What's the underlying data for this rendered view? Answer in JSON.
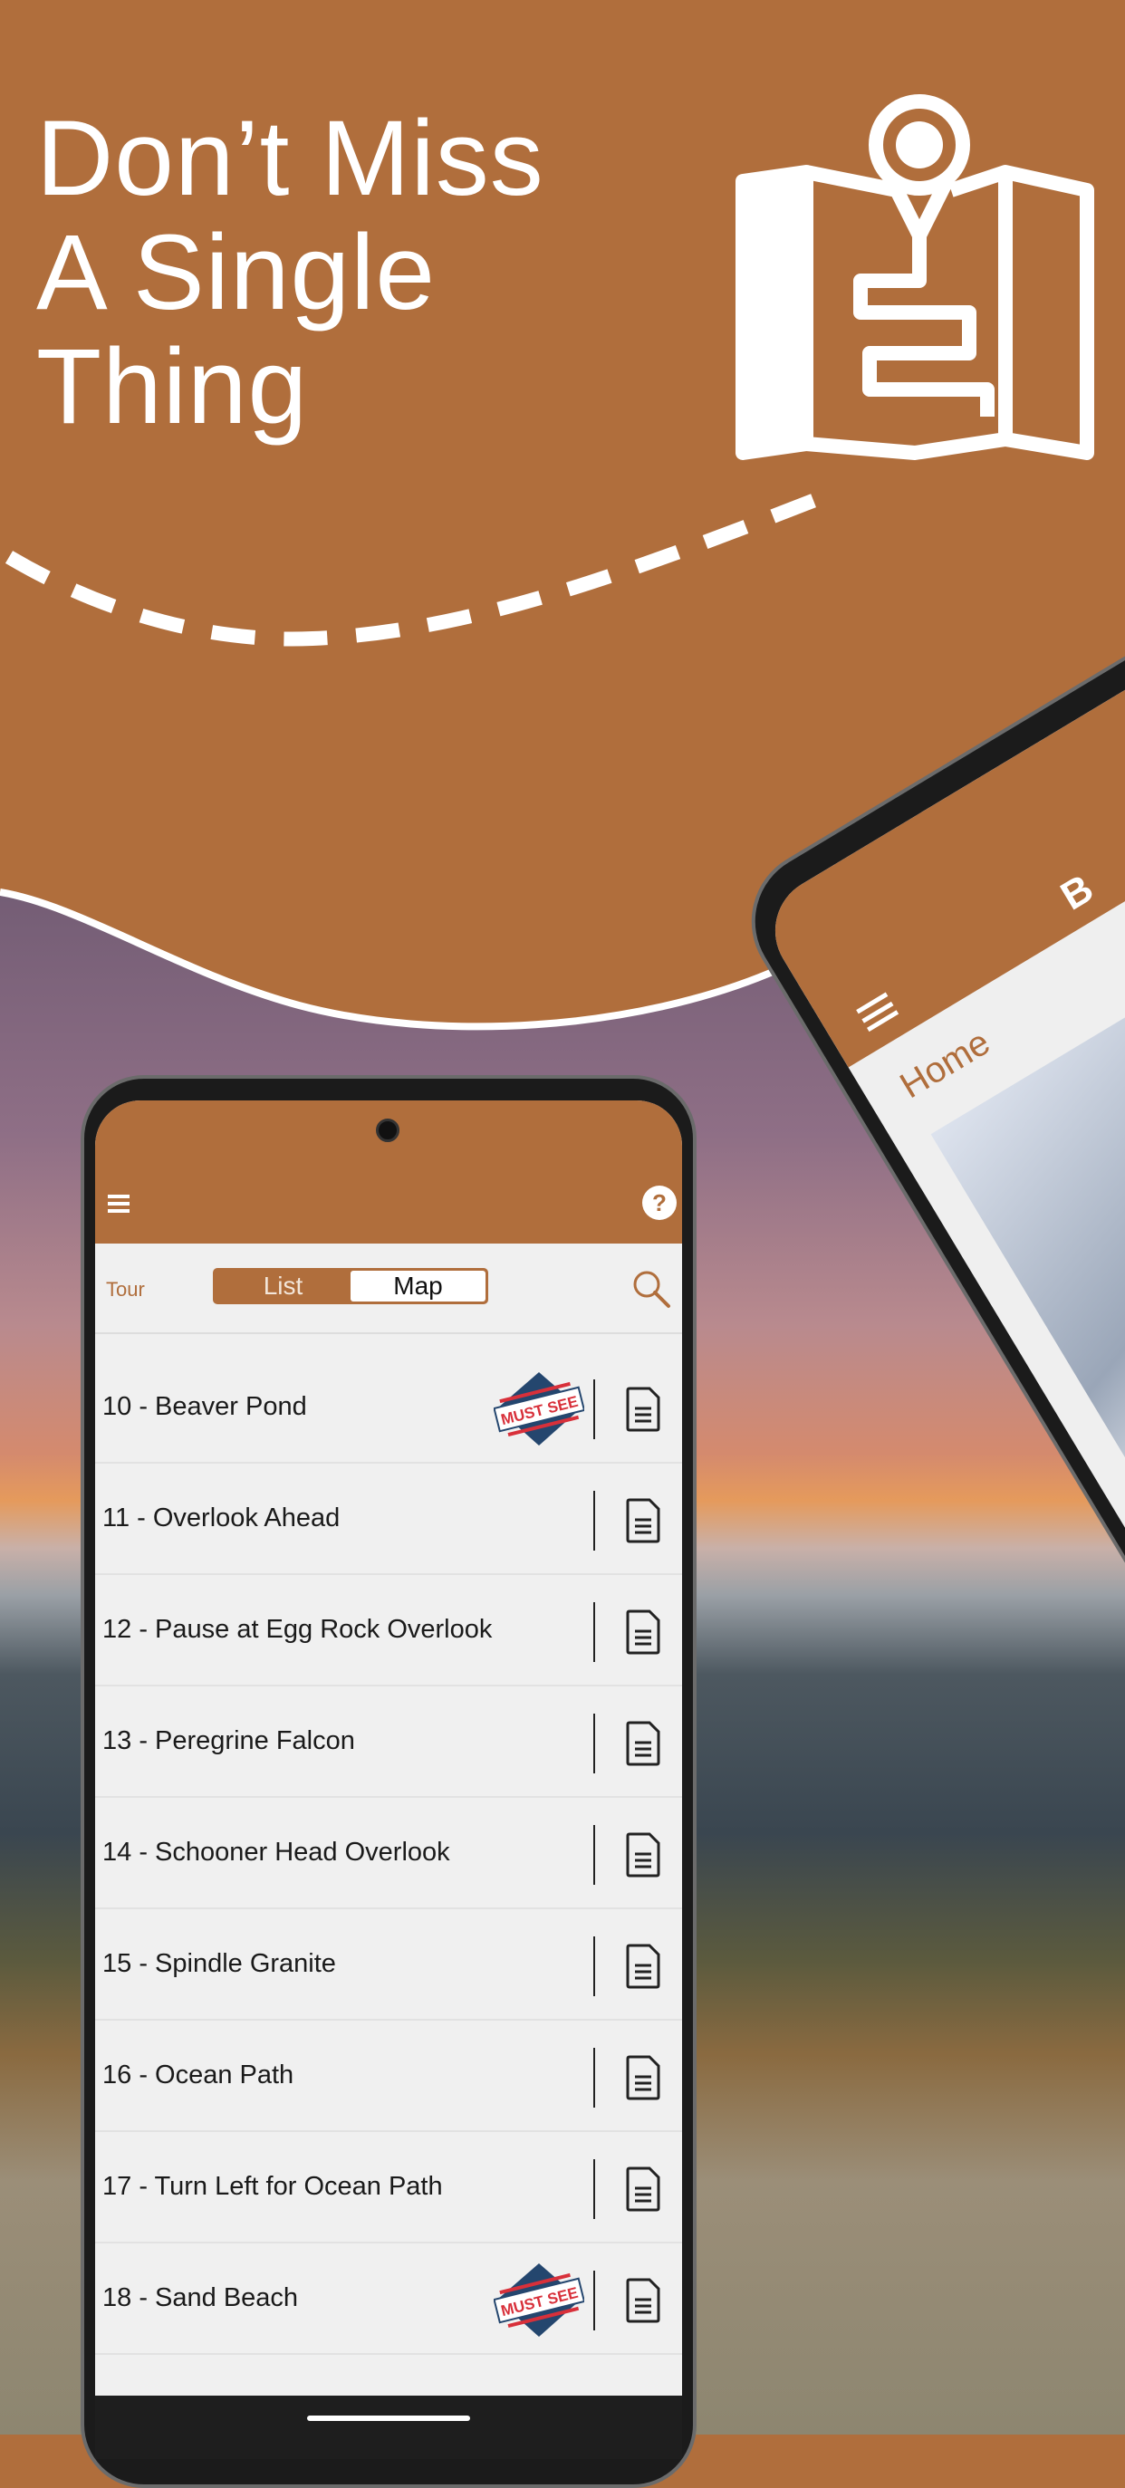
{
  "headline": {
    "line1": "Don’t Miss",
    "line2": "A Single",
    "line3": "Thing"
  },
  "colors": {
    "brand": "#b06e3c",
    "badge_blue": "#24466e",
    "badge_red": "#d8303a"
  },
  "phone": {
    "toolbar": {
      "tour_label": "Tour",
      "list_label": "List",
      "map_label": "Map",
      "selected": "Map"
    },
    "icons": {
      "menu": "hamburger-icon",
      "help": "help-bubble-icon",
      "search": "search-icon",
      "doc": "document-icon"
    },
    "stops": [
      {
        "label": "10 - Beaver Pond",
        "must_see": true
      },
      {
        "label": "11 - Overlook Ahead",
        "must_see": false
      },
      {
        "label": "12 - Pause at Egg Rock Overlook",
        "must_see": false
      },
      {
        "label": "13 - Peregrine Falcon",
        "must_see": false
      },
      {
        "label": "14 - Schooner Head Overlook",
        "must_see": false
      },
      {
        "label": "15 - Spindle Granite",
        "must_see": false
      },
      {
        "label": "16 - Ocean Path",
        "must_see": false
      },
      {
        "label": "17 - Turn Left for Ocean Path",
        "must_see": false
      },
      {
        "label": "18 - Sand Beach",
        "must_see": true
      }
    ],
    "badge_text": "MUST SEE"
  },
  "phone2": {
    "title": "B",
    "tab": "Home"
  }
}
